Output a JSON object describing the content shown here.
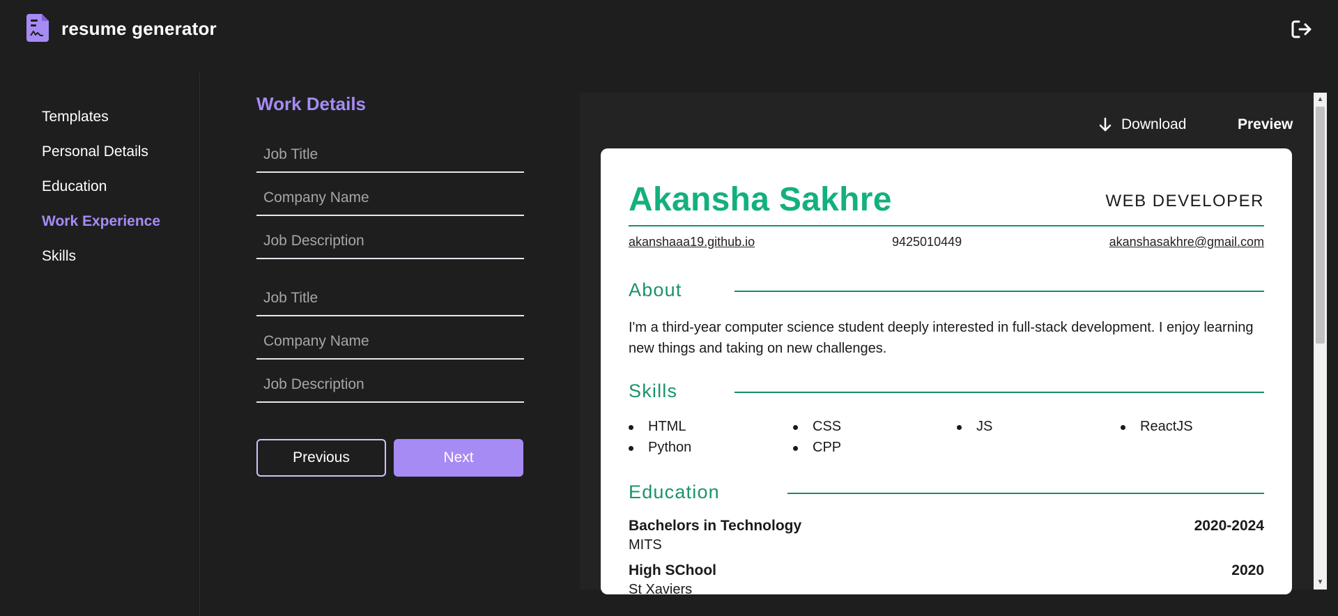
{
  "header": {
    "app_title": "resume generator",
    "logo_icon": "resume-document-icon",
    "logout_icon": "logout-icon"
  },
  "sidebar": {
    "items": [
      {
        "label": "Templates",
        "active": false
      },
      {
        "label": "Personal Details",
        "active": false
      },
      {
        "label": "Education",
        "active": false
      },
      {
        "label": "Work Experience",
        "active": true
      },
      {
        "label": "Skills",
        "active": false
      }
    ]
  },
  "form": {
    "title": "Work Details",
    "entries": [
      {
        "job_title": {
          "value": "",
          "placeholder": "Job Title"
        },
        "company_name": {
          "value": "",
          "placeholder": "Company Name"
        },
        "job_description": {
          "value": "",
          "placeholder": "Job Description"
        }
      },
      {
        "job_title": {
          "value": "",
          "placeholder": "Job Title"
        },
        "company_name": {
          "value": "",
          "placeholder": "Company Name"
        },
        "job_description": {
          "value": "",
          "placeholder": "Job Description"
        }
      }
    ],
    "previous_label": "Previous",
    "next_label": "Next"
  },
  "preview_toolbar": {
    "download_label": "Download",
    "download_icon": "arrow-down-icon",
    "preview_label": "Preview"
  },
  "resume": {
    "name": "Akansha Sakhre",
    "role": "WEB DEVELOPER",
    "website": "akanshaaa19.github.io",
    "phone": "9425010449",
    "email": "akanshasakhre@gmail.com",
    "about_heading": "About",
    "about_text": "I'm a third-year computer science student deeply interested in full-stack development. I enjoy learning new things and taking on new challenges.",
    "skills_heading": "Skills",
    "skills": [
      "HTML",
      "CSS",
      "JS",
      "ReactJS",
      "Python",
      "CPP"
    ],
    "education_heading": "Education",
    "education": [
      {
        "degree": "Bachelors in Technology",
        "school": "MITS",
        "year": "2020-2024"
      },
      {
        "degree": "High SChool",
        "school": "St Xaviers",
        "year": "2020"
      }
    ]
  },
  "colors": {
    "background": "#1e1e1f",
    "accent_purple": "#a68bf5",
    "resume_green": "#13b07e"
  }
}
